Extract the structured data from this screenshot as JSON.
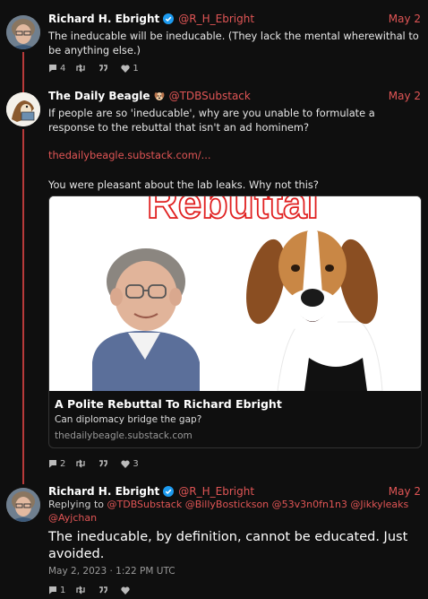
{
  "tweets": [
    {
      "display_name": "Richard H. Ebright",
      "handle": "@R_H_Ebright",
      "date": "May 2",
      "text": "The ineducable will be ineducable. (They lack the mental wherewithal to be anything else.)",
      "replies": "4",
      "retweets": "",
      "quotes": "",
      "likes": "1"
    },
    {
      "display_name": "The Daily Beagle",
      "handle": "@TDBSubstack",
      "date": "May 2",
      "text": "If people are so 'ineducable', why are you unable to formulate a response to the rebuttal that isn't an ad hominem?",
      "link": "thedailybeagle.substack.com/...",
      "text2": "You were pleasant about the lab leaks. Why not this?",
      "card": {
        "banner_text": "Rebuttal",
        "title": "A Polite Rebuttal To Richard Ebright",
        "description": "Can diplomacy bridge the gap?",
        "domain": "thedailybeagle.substack.com"
      },
      "replies": "2",
      "retweets": "",
      "quotes": "",
      "likes": "3"
    },
    {
      "display_name": "Richard H. Ebright",
      "handle": "@R_H_Ebright",
      "date": "May 2",
      "replying_prefix": "Replying to",
      "replying_to": "@TDBSubstack @BillyBostickson @53v3n0fn1n3 @Jikkyleaks @Ayjchan",
      "text": "The ineducable, by definition, cannot be educated. Just avoided.",
      "timestamp": "May 2, 2023 · 1:22 PM UTC",
      "replies": "1",
      "retweets": "",
      "quotes": "",
      "likes": ""
    }
  ],
  "colors": {
    "accent": "#e05555",
    "thread_line": "#b83a3a",
    "verified": "#1d9bf0",
    "background": "#0f0f0f"
  },
  "icons": [
    "verified-icon",
    "reply-icon",
    "retweet-icon",
    "quote-icon",
    "heart-icon"
  ]
}
